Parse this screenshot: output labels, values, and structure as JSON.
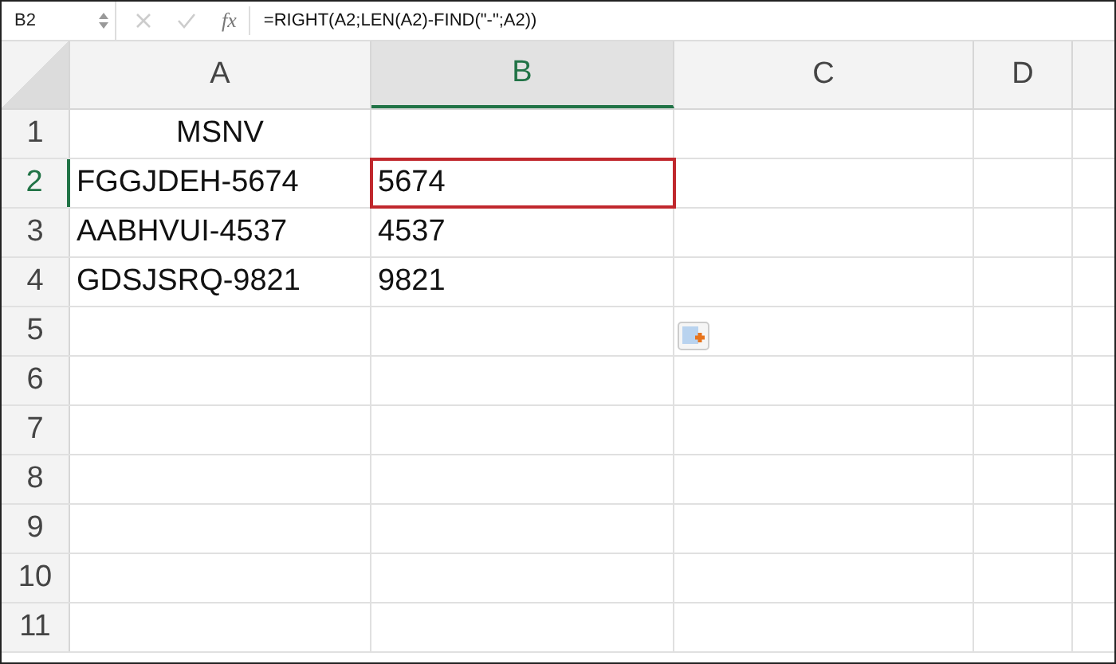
{
  "name_box": "B2",
  "formula_bar": {
    "fx": "fx",
    "formula": "=RIGHT(A2;LEN(A2)-FIND(\"-\";A2))"
  },
  "columns": [
    {
      "label": "A",
      "selected": false
    },
    {
      "label": "B",
      "selected": true
    },
    {
      "label": "C",
      "selected": false
    },
    {
      "label": "D",
      "selected": false
    }
  ],
  "rows": [
    {
      "label": "1",
      "selected": false,
      "cells": [
        {
          "text": "MSNV",
          "centered": true
        }
      ]
    },
    {
      "label": "2",
      "selected": true,
      "cells": [
        {
          "text": "FGGJDEH-5674"
        },
        {
          "text": "5674",
          "selected": true
        }
      ]
    },
    {
      "label": "3",
      "selected": false,
      "cells": [
        {
          "text": "AABHVUI-4537"
        },
        {
          "text": "4537"
        }
      ]
    },
    {
      "label": "4",
      "selected": false,
      "cells": [
        {
          "text": "GDSJSRQ-9821"
        },
        {
          "text": "9821"
        }
      ]
    },
    {
      "label": "5",
      "selected": false,
      "cells": [],
      "paste_options": true
    },
    {
      "label": "6",
      "selected": false,
      "cells": []
    },
    {
      "label": "7",
      "selected": false,
      "cells": []
    },
    {
      "label": "8",
      "selected": false,
      "cells": []
    },
    {
      "label": "9",
      "selected": false,
      "cells": []
    },
    {
      "label": "10",
      "selected": false,
      "cells": []
    },
    {
      "label": "11",
      "selected": false,
      "cells": []
    }
  ]
}
